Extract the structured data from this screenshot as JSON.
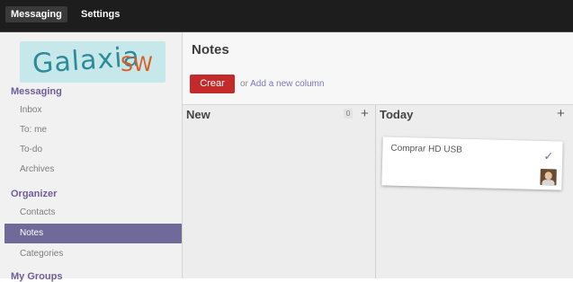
{
  "topbar": {
    "messaging": "Messaging",
    "settings": "Settings"
  },
  "logo": {
    "main": "Galaxia",
    "sub": "SW"
  },
  "sidebar": {
    "messaging_title": "Messaging",
    "items_messaging": [
      "Inbox",
      "To: me",
      "To-do",
      "Archives"
    ],
    "organizer_title": "Organizer",
    "items_organizer": [
      "Contacts",
      "Notes",
      "Categories"
    ],
    "groups_title": "My Groups"
  },
  "header": {
    "title": "Notes",
    "create_label": "Crear",
    "add_column_or": "or",
    "add_column_link": "Add a new column"
  },
  "columns": [
    {
      "title": "New",
      "count": "0",
      "plus": "+"
    },
    {
      "title": "Today",
      "plus": "+",
      "note": {
        "text": "Comprar HD USB",
        "check": "✓"
      }
    }
  ]
}
